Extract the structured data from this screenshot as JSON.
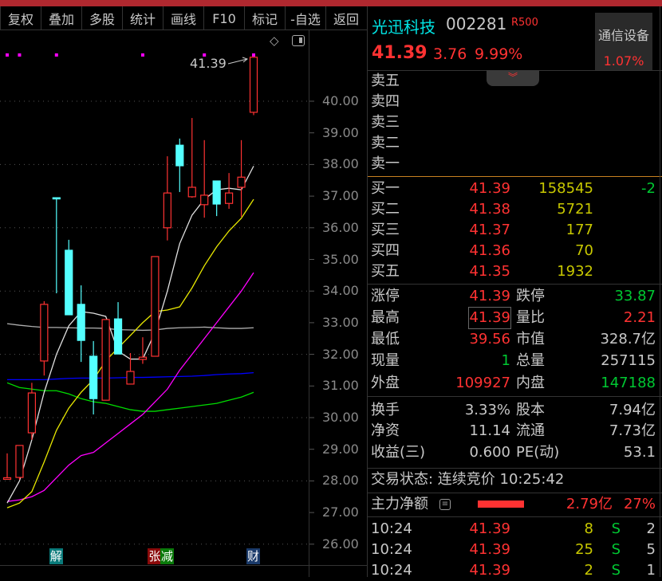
{
  "toolbar": {
    "buttons": [
      "复权",
      "叠加",
      "多股",
      "统计",
      "画线",
      "F10",
      "标记",
      "-自选",
      "返回"
    ]
  },
  "chart": {
    "y_ticks": [
      "40.00",
      "39.00",
      "38.00",
      "37.00",
      "36.00",
      "35.00",
      "34.00",
      "33.00",
      "32.00",
      "31.00",
      "30.00",
      "29.00",
      "28.00",
      "27.00",
      "26.00"
    ],
    "last_price_label": "41.39",
    "colors": {
      "up": "#ff3232",
      "down": "#54ffff",
      "ma5": "#e0e0e0",
      "ma10": "#e8e800",
      "ma20": "#ff00ff",
      "ma60": "#00dd00",
      "ma120": "#0000ff",
      "ma250": "#b0b0b0"
    },
    "candles": [
      [
        28.05,
        28.87,
        28.05,
        28.1
      ],
      [
        28.11,
        29.12,
        28.04,
        29.12
      ],
      [
        29.52,
        31.1,
        29.3,
        30.78
      ],
      [
        31.79,
        33.68,
        31.33,
        33.58
      ],
      [
        36.95,
        36.95,
        33.93,
        36.93
      ],
      [
        35.29,
        35.62,
        33.25,
        33.25
      ],
      [
        33.58,
        34.18,
        31.76,
        32.44
      ],
      [
        31.94,
        32.42,
        30.1,
        30.6
      ],
      [
        30.55,
        33.1,
        30.55,
        33.1
      ],
      [
        33.12,
        33.65,
        32.01,
        32.01
      ],
      [
        31.06,
        32.04,
        31.06,
        31.46
      ],
      [
        31.84,
        32.54,
        31.7,
        31.91
      ],
      [
        31.94,
        35.09,
        31.94,
        35.09
      ],
      [
        36.0,
        38.26,
        35.6,
        37.1
      ],
      [
        38.61,
        38.82,
        37.13,
        37.96
      ],
      [
        36.98,
        39.47,
        36.95,
        37.28
      ],
      [
        36.73,
        38.77,
        36.32,
        37.03
      ],
      [
        37.48,
        37.48,
        36.37,
        36.75
      ],
      [
        36.77,
        37.73,
        36.6,
        37.1
      ],
      [
        37.28,
        38.77,
        36.35,
        37.6
      ],
      [
        39.65,
        41.39,
        39.56,
        41.39
      ]
    ],
    "ma": {
      "ma5": [
        27.3,
        28.0,
        29.3,
        30.8,
        32.0,
        32.9,
        33.35,
        33.3,
        33.2,
        32.1,
        31.85,
        31.85,
        32.7,
        34.0,
        35.5,
        36.4,
        36.9,
        37.2,
        37.25,
        37.2,
        37.95
      ],
      "ma10": [
        27.15,
        27.3,
        27.66,
        28.6,
        29.6,
        30.3,
        30.8,
        31.2,
        31.8,
        32.2,
        32.6,
        33.0,
        33.35,
        33.4,
        33.5,
        34.1,
        34.8,
        35.4,
        35.9,
        36.3,
        36.9
      ],
      "ma20": [
        27.35,
        27.4,
        27.5,
        27.7,
        28.1,
        28.5,
        28.8,
        28.9,
        29.2,
        29.5,
        29.8,
        30.1,
        30.5,
        30.9,
        31.5,
        32.0,
        32.5,
        33.0,
        33.5,
        34.0,
        34.58
      ],
      "ma60": [
        31.1,
        30.95,
        30.9,
        30.85,
        30.85,
        30.75,
        30.6,
        30.5,
        30.45,
        30.35,
        30.25,
        30.2,
        30.2,
        30.25,
        30.3,
        30.35,
        30.4,
        30.45,
        30.55,
        30.65,
        30.8
      ],
      "ma120": [
        31.2,
        31.2,
        31.2,
        31.2,
        31.22,
        31.24,
        31.25,
        31.25,
        31.25,
        31.26,
        31.27,
        31.27,
        31.28,
        31.29,
        31.3,
        31.31,
        31.33,
        31.36,
        31.38,
        31.39,
        31.42
      ],
      "ma250": [
        32.97,
        32.92,
        32.88,
        32.85,
        32.85,
        32.84,
        32.83,
        32.83,
        32.82,
        32.78,
        32.77,
        32.76,
        32.77,
        32.82,
        32.84,
        32.85,
        32.86,
        32.84,
        32.82,
        32.82,
        32.84
      ]
    },
    "markers": [
      {
        "text": "解",
        "index": 4,
        "color": "#0a7a7a"
      },
      {
        "text": "张",
        "index": 12,
        "color": "#8a0a0a"
      },
      {
        "text": "减",
        "index": 13,
        "color": "#0a7a0a"
      },
      {
        "text": "财",
        "index": 20,
        "color": "#1a3a6a"
      }
    ],
    "dot_indices": [
      0,
      1,
      4,
      11,
      16,
      20
    ]
  },
  "quote": {
    "name": "光迅科技",
    "code": "002281",
    "badge": "R500",
    "price": "41.39",
    "change": "3.76",
    "change_pct": "9.99%",
    "industry": "通信设备",
    "industry_pct": "1.07%"
  },
  "sell": [
    {
      "label": "卖五"
    },
    {
      "label": "卖四"
    },
    {
      "label": "卖三"
    },
    {
      "label": "卖二"
    },
    {
      "label": "卖一"
    }
  ],
  "buy": [
    {
      "label": "买一",
      "price": "41.39",
      "vol": "158545",
      "delta": "-2"
    },
    {
      "label": "买二",
      "price": "41.38",
      "vol": "5721"
    },
    {
      "label": "买三",
      "price": "41.37",
      "vol": "177"
    },
    {
      "label": "买四",
      "price": "41.36",
      "vol": "70"
    },
    {
      "label": "买五",
      "price": "41.35",
      "vol": "1932"
    }
  ],
  "stats": [
    {
      "l1": "涨停",
      "v1": "41.39",
      "l2": "跌停",
      "v2": "33.87"
    },
    {
      "l1": "最高",
      "v1": "41.39",
      "l2": "量比",
      "v2": "2.21"
    },
    {
      "l1": "最低",
      "v1": "39.56",
      "l2": "市值",
      "v2": "328.7亿"
    },
    {
      "l1": "现量",
      "v1": "1",
      "l2": "总量",
      "v2": "257115"
    },
    {
      "l1": "外盘",
      "v1": "109927",
      "l2": "内盘",
      "v2": "147188"
    },
    {
      "l1": "换手",
      "v1": "3.33%",
      "l2": "股本",
      "v2": "7.94亿"
    },
    {
      "l1": "净资",
      "v1": "11.14",
      "l2": "流通",
      "v2": "7.73亿"
    },
    {
      "l1": "收益(三)",
      "v1": "0.600",
      "l2": "PE(动)",
      "v2": "53.1"
    }
  ],
  "status": {
    "text": "交易状态: 连续竞价 10:25:42"
  },
  "flow": {
    "label": "主力净额",
    "amount": "2.79亿",
    "pct": "27%"
  },
  "ticks": [
    {
      "time": "10:24",
      "price": "41.39",
      "vol": "8",
      "side": "S",
      "n": "2"
    },
    {
      "time": "10:24",
      "price": "41.39",
      "vol": "25",
      "side": "S",
      "n": "5"
    },
    {
      "time": "10:24",
      "price": "41.39",
      "vol": "2",
      "side": "S",
      "n": "1"
    }
  ]
}
